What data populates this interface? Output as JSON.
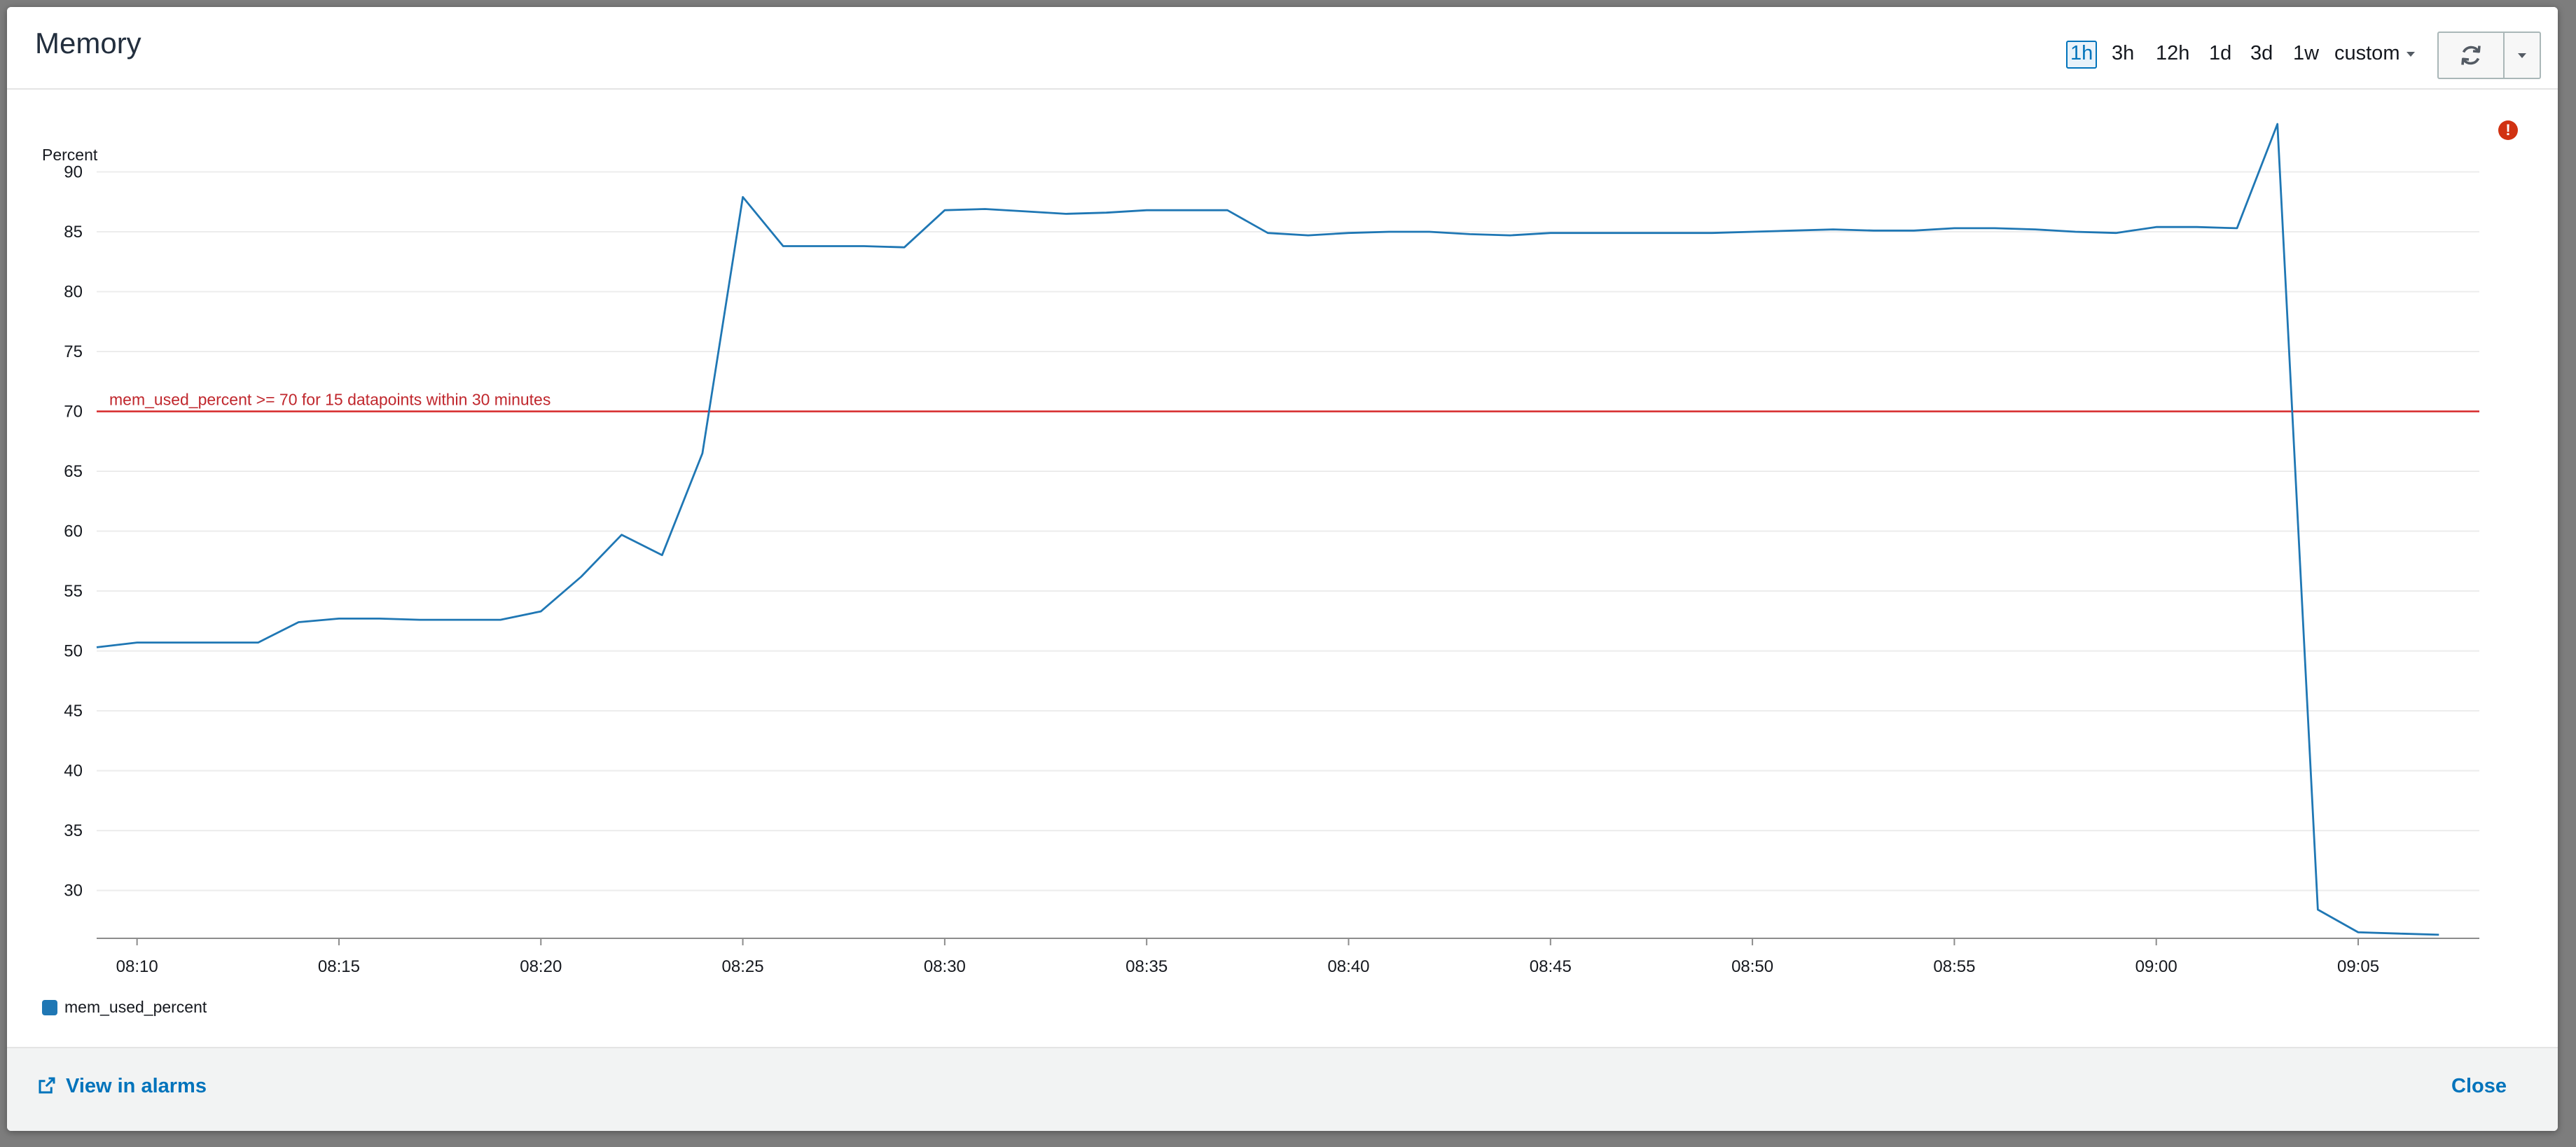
{
  "modal": {
    "title": "Memory"
  },
  "period_selector": {
    "options": [
      "1h",
      "3h",
      "12h",
      "1d",
      "3d",
      "1w"
    ],
    "active": "1h",
    "custom_label": "custom"
  },
  "icons": {
    "refresh": "refresh-icon",
    "dropdown": "caret-down-icon",
    "alarm": "alarm-exclamation-icon",
    "external_link": "external-link-icon"
  },
  "footer": {
    "view_in_alarms": "View in alarms",
    "close": "Close"
  },
  "colors": {
    "series": "#1f77b4",
    "threshold": "#d62728",
    "link": "#0073bb",
    "alarm": "#d13212"
  },
  "chart_data": {
    "type": "line",
    "title": "Memory",
    "ylabel": "Percent",
    "xlabel": "",
    "ylim": [
      26,
      95
    ],
    "yticks": [
      30,
      35,
      40,
      45,
      50,
      55,
      60,
      65,
      70,
      75,
      80,
      85,
      90
    ],
    "xticks": [
      "08:10",
      "08:15",
      "08:20",
      "08:25",
      "08:30",
      "08:35",
      "08:40",
      "08:45",
      "08:50",
      "08:55",
      "09:00",
      "09:05"
    ],
    "grid": true,
    "legend_position": "bottom-left",
    "series": [
      {
        "name": "mem_used_percent",
        "x": [
          "08:09",
          "08:10",
          "08:11",
          "08:12",
          "08:13",
          "08:14",
          "08:15",
          "08:16",
          "08:17",
          "08:18",
          "08:19",
          "08:20",
          "08:21",
          "08:22",
          "08:23",
          "08:24",
          "08:25",
          "08:26",
          "08:27",
          "08:28",
          "08:29",
          "08:30",
          "08:31",
          "08:32",
          "08:33",
          "08:34",
          "08:35",
          "08:36",
          "08:37",
          "08:38",
          "08:39",
          "08:40",
          "08:41",
          "08:42",
          "08:43",
          "08:44",
          "08:45",
          "08:46",
          "08:47",
          "08:48",
          "08:49",
          "08:50",
          "08:51",
          "08:52",
          "08:53",
          "08:54",
          "08:55",
          "08:56",
          "08:57",
          "08:58",
          "08:59",
          "09:00",
          "09:01",
          "09:02",
          "09:03",
          "09:04",
          "09:05",
          "09:06",
          "09:07"
        ],
        "values": [
          50.3,
          50.7,
          50.7,
          50.7,
          50.7,
          52.4,
          52.7,
          52.7,
          52.6,
          52.6,
          52.6,
          53.3,
          56.2,
          59.7,
          58.0,
          66.5,
          87.9,
          83.8,
          83.8,
          83.8,
          83.7,
          86.8,
          86.9,
          86.7,
          86.5,
          86.6,
          86.8,
          86.8,
          86.8,
          84.9,
          84.7,
          84.9,
          85.0,
          85.0,
          84.8,
          84.7,
          84.9,
          84.9,
          84.9,
          84.9,
          84.9,
          85.0,
          85.1,
          85.2,
          85.1,
          85.1,
          85.3,
          85.3,
          85.2,
          85.0,
          84.9,
          85.4,
          85.4,
          85.3,
          94.0,
          28.4,
          26.5,
          26.4,
          26.3
        ]
      }
    ],
    "threshold": {
      "value": 70,
      "label": "mem_used_percent >= 70 for 15 datapoints within 30 minutes"
    }
  }
}
